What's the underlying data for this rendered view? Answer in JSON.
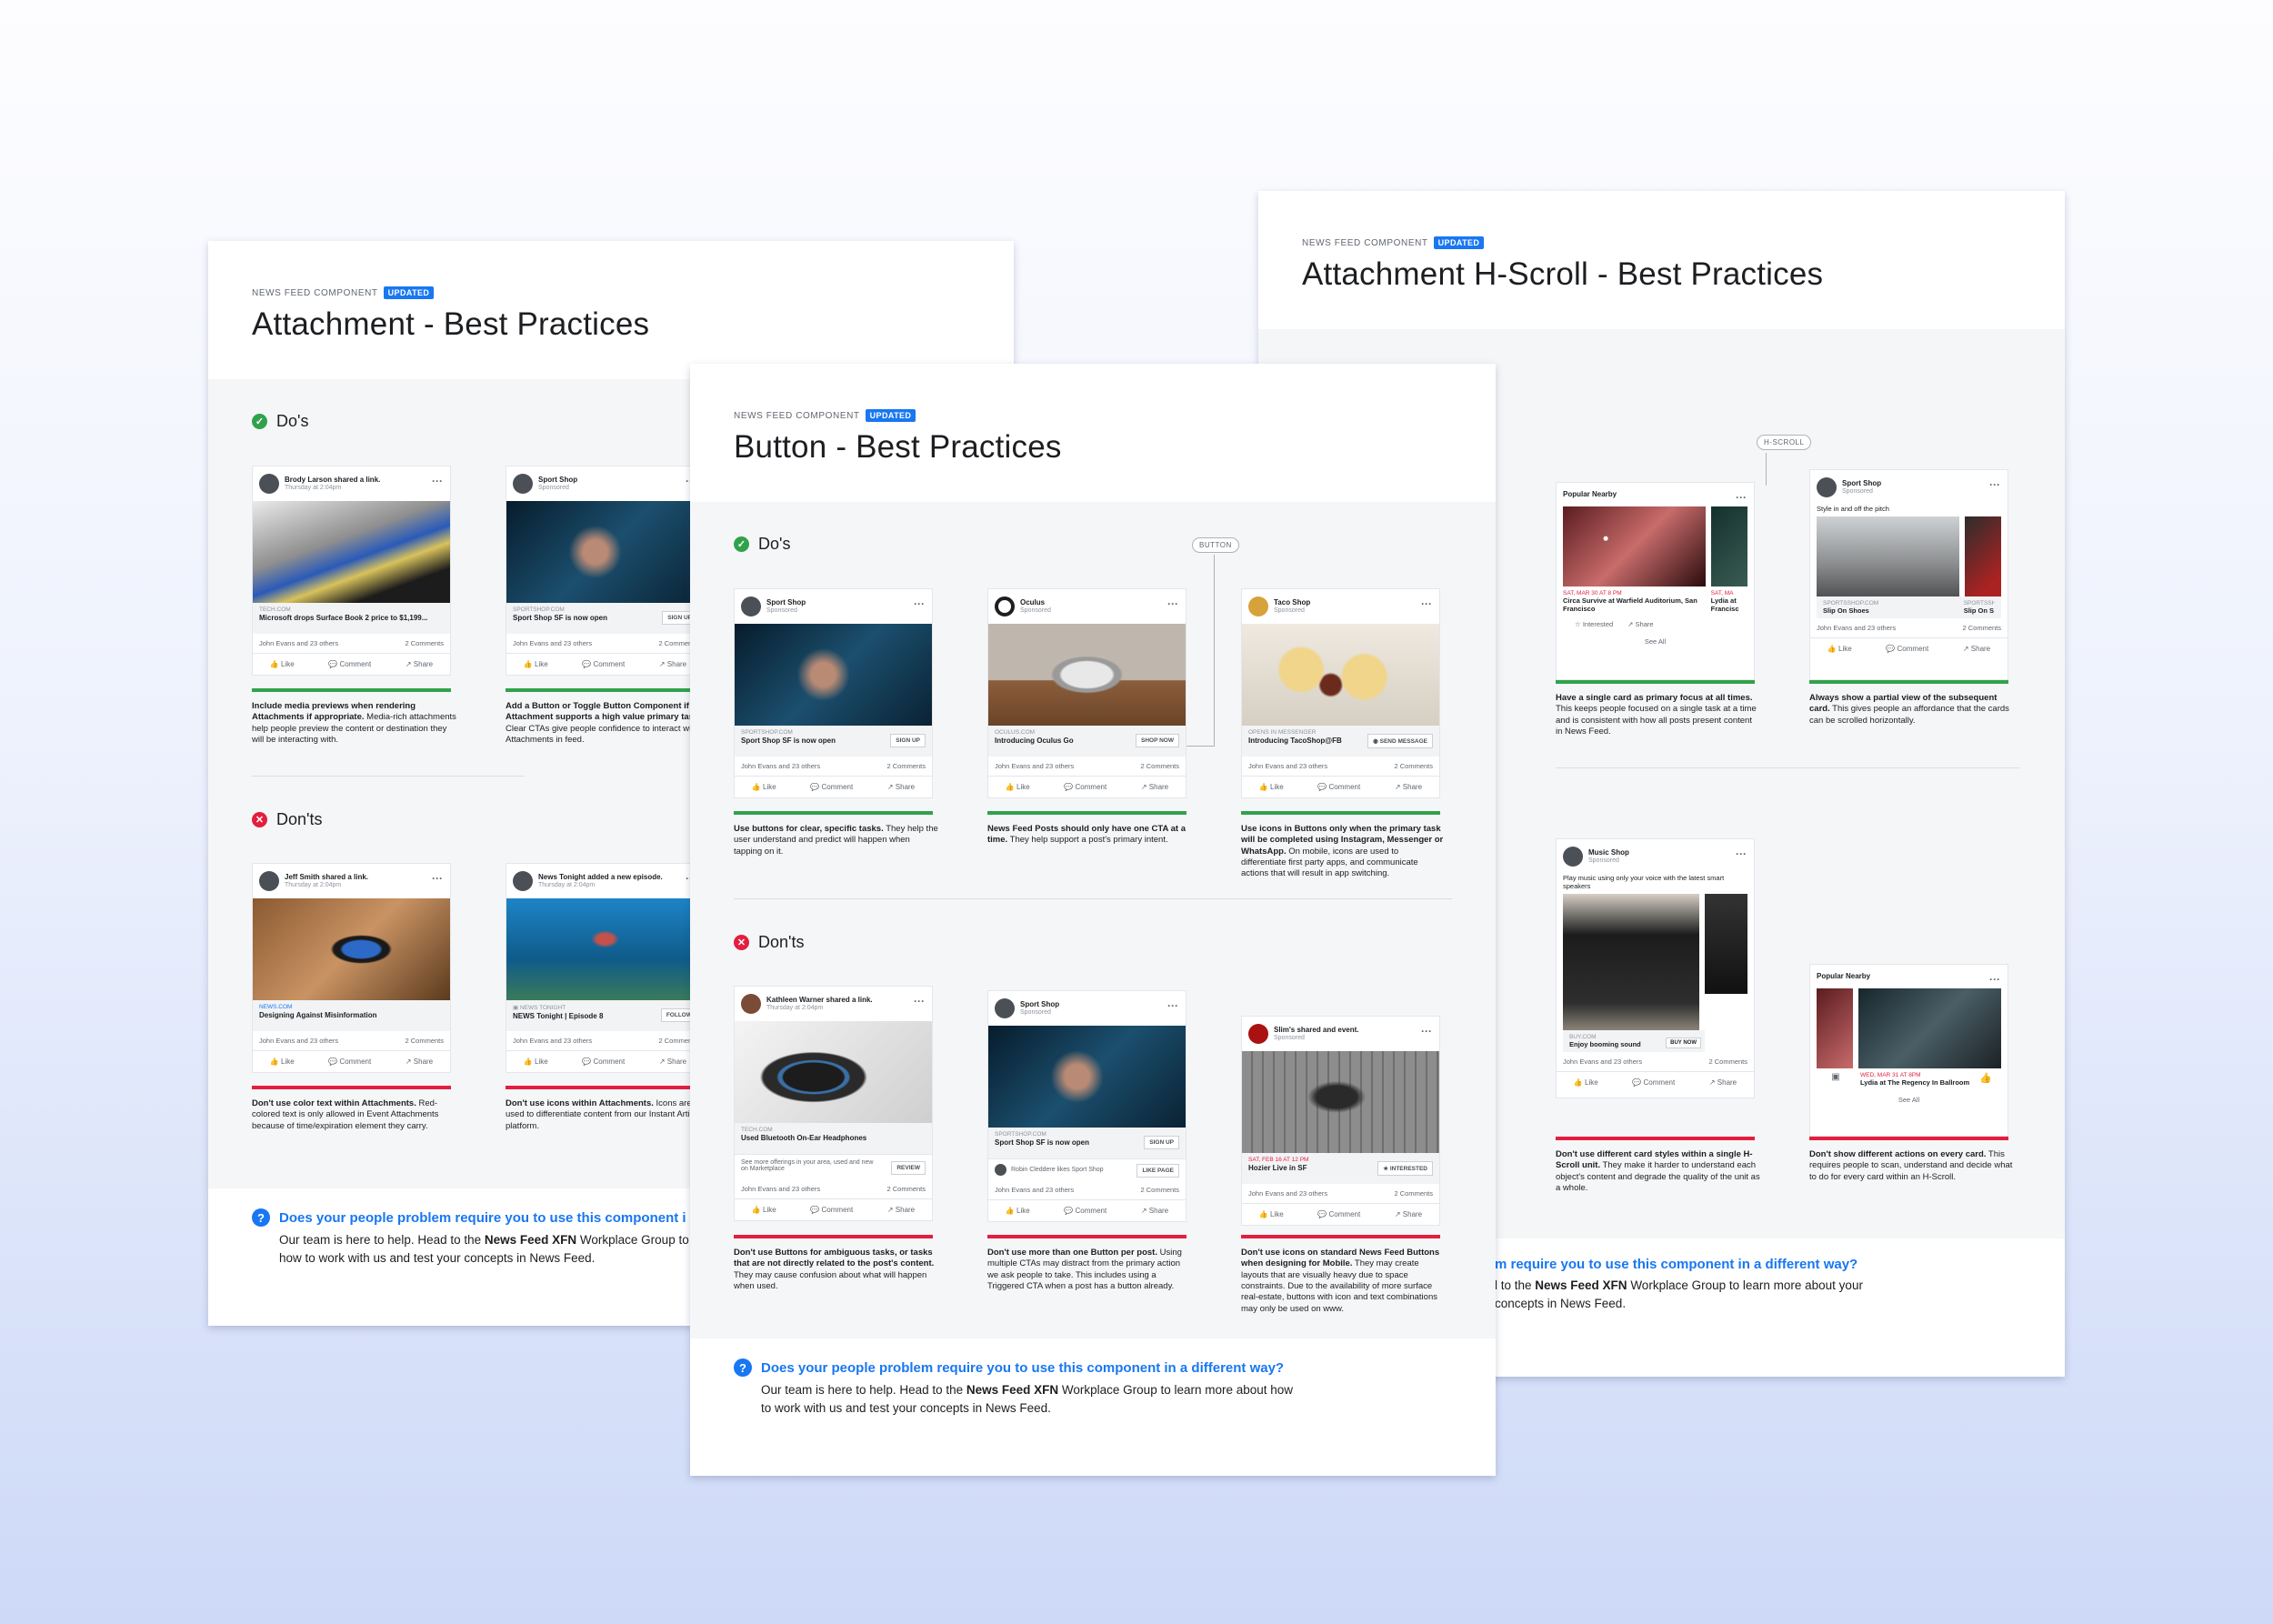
{
  "common": {
    "kicker": "NEWS FEED COMPONENT",
    "badge": "UPDATED",
    "dos": "Do's",
    "donts": "Don'ts",
    "like": "Like",
    "comment": "Comment",
    "share": "Share",
    "reactions": "John Evans and 23 others",
    "comments": "2 Comments",
    "footer_q": "Does your people problem require you to use this component in a different way?",
    "footer_t1": "Our team is here to help. Head to the ",
    "footer_bold": "News Feed XFN",
    "footer_t2": " Workplace Group to learn more about how to work with us and test your concepts in News Feed."
  },
  "attachment": {
    "title": "Attachment - Best Practices",
    "do1": {
      "who": "Brody Larson shared a link.",
      "sub": "Thursday at 2:04pm",
      "dom": "TECH.COM",
      "hl": "Microsoft drops Surface Book 2 price to $1,199...",
      "cap_b": "Include media previews when rendering Attachments if appropriate.",
      "cap": " Media-rich attachments help people preview the content or destination they will be interacting with."
    },
    "do2": {
      "who": "Sport Shop",
      "sub": "Sponsored",
      "dom": "SPORTSHOP.COM",
      "hl": "Sport Shop SF is now open",
      "cta": "SIGN UP",
      "cap_b": "Add a Button or Toggle Button Component if Attachment supports a high value primary task.",
      "cap": " Clear CTAs give people confidence to interact with Attachments in feed."
    },
    "dont1": {
      "who": "Jeff Smith shared a link.",
      "sub": "Thursday at 2:04pm",
      "dom": "NEWS.COM",
      "hl": "Designing Against Misinformation",
      "cap_b": "Don't use color text within Attachments.",
      "cap": " Red-colored text is only allowed in Event Attachments because of time/expiration element they carry."
    },
    "dont2": {
      "who": "News Tonight added a new episode.",
      "sub": "Thursday at 2:04pm",
      "dom": "NEWS TONIGHT",
      "hl": "NEWS Tonight | Episode 8",
      "cta": "FOLLOW",
      "cap_b": "Don't use icons within Attachments.",
      "cap": " Icons are only used to differentiate content from our Instant Articles platform."
    }
  },
  "button": {
    "title": "Button - Best Practices",
    "pill": "BUTTON",
    "do1": {
      "who": "Sport Shop",
      "sub": "Sponsored",
      "dom": "SPORTSHOP.COM",
      "hl": "Sport Shop SF is now open",
      "cta": "SIGN UP",
      "cap_b": "Use buttons for clear, specific tasks.",
      "cap": " They help the user understand and predict will happen when tapping on it."
    },
    "do2": {
      "who": "Oculus",
      "sub": "Sponsored",
      "dom": "OCULUS.COM",
      "hl": "Introducing Oculus Go",
      "cta": "SHOP NOW",
      "cap_b": "News Feed Posts should only have one CTA at a time.",
      "cap": " They help support a post's primary intent."
    },
    "do3": {
      "who": "Taco Shop",
      "sub": "Sponsored",
      "dom": "OPENS IN MESSENGER",
      "hl": "Introducing TacoShop@FB",
      "cta": "SEND MESSAGE",
      "cap_b": "Use icons in Buttons only when the primary task will be completed using Instagram, Messenger or WhatsApp.",
      "cap": " On mobile, icons are used to differentiate first party apps, and communicate actions that will result in app switching."
    },
    "dont1": {
      "who": "Kathleen Warner shared a link.",
      "sub": "Thursday at 2:04pm",
      "dom": "TECH.COM",
      "hl": "Used Bluetooth On-Ear Headphones",
      "extra": "See more offerings in your area, used and new on Marketplace",
      "cta": "REVIEW",
      "cap_b": "Don't use Buttons for ambiguous tasks, or tasks that are not directly related to the post's content.",
      "cap": " They may cause confusion about what will happen when used."
    },
    "dont2": {
      "who": "Sport Shop",
      "sub": "Sponsored",
      "dom": "SPORTSHOP.COM",
      "hl": "Sport Shop SF is now open",
      "cta": "SIGN UP",
      "extra": "Robin Cleddere likes Sport Shop",
      "cta2": "LIKE PAGE",
      "cap_b": "Don't use more than one Button per post.",
      "cap": " Using multiple CTAs may distract from the primary action we ask people to take. This includes using a Triggered CTA when a post has a button already."
    },
    "dont3": {
      "who": "Slim's shared and event.",
      "sub": "Sponsored",
      "dom": "SAT, FEB 16 AT 12 PM",
      "hl": "Hozier Live in SF",
      "cta": "INTERESTED",
      "cap_b": "Don't use icons on standard News Feed Buttons when designing for Mobile.",
      "cap": " They may create layouts that are visually heavy due to space constraints. Due to the availability of more surface real-estate, buttons with icon and text combinations may only be used on www."
    }
  },
  "hscroll": {
    "title": "Attachment H-Scroll - Best Practices",
    "pill": "H-SCROLL",
    "do1": {
      "who": "Popular Nearby",
      "date": "SAT, MAR 30 AT 8 PM",
      "hl": "Circa Survive at Warfield Auditorium, San Francisco",
      "date2": "SAT, MA",
      "hl2": "Lydia at Francisc",
      "interested": "Interested",
      "see": "See All",
      "cap_b": "Have a single card as primary focus at all times.",
      "cap": " This keeps people focused on a single task at a time and is consistent with how all posts present content in News Feed."
    },
    "do2": {
      "who": "Sport Shop",
      "sub": "Sponsored",
      "text": "Style in and off the pitch",
      "dom": "SPORTSSHOP.COM",
      "hl": "Slip On Shoes",
      "dom2": "SPORTSSH",
      "hl2": "Slip On S",
      "cap_b": "Always show a partial view of the subsequent card.",
      "cap": " This gives people an affordance that the cards can be scrolled horizontally."
    },
    "dont1": {
      "who": "Music Shop",
      "sub": "Sponsored",
      "text": "Play music using only your voice with the latest smart speakers",
      "dom": "BUY.COM",
      "hl": "Enjoy booming sound",
      "cta": "BUY NOW",
      "cap_b": "Don't use different card styles within a single H-Scroll unit.",
      "cap": " They make it harder to understand each object's content and degrade the quality of the unit as a whole."
    },
    "dont2": {
      "who": "Popular Nearby",
      "date": "WED, MAR 31 AT 8PM",
      "hl": "Lydia at The Regency In Ballroom",
      "see": "See All",
      "cap_b": "Don't show different actions on every card.",
      "cap": " This requires people to scan, understand and decide what to do for every card within an H-Scroll."
    },
    "footer_q": "m require you to use this component in a different way?",
    "footer_t1": "l to the ",
    "footer_bold": "News Feed XFN",
    "footer_t2": " Workplace Group to learn more about your concepts in News Feed."
  },
  "attachment_footer": {
    "q": "Does your people problem require you to use this component i",
    "t1": "Our team is here to help. Head to the ",
    "bold": "News Feed XFN",
    "t2": " Workplace Group to how to work with us and test your concepts in News Feed."
  }
}
